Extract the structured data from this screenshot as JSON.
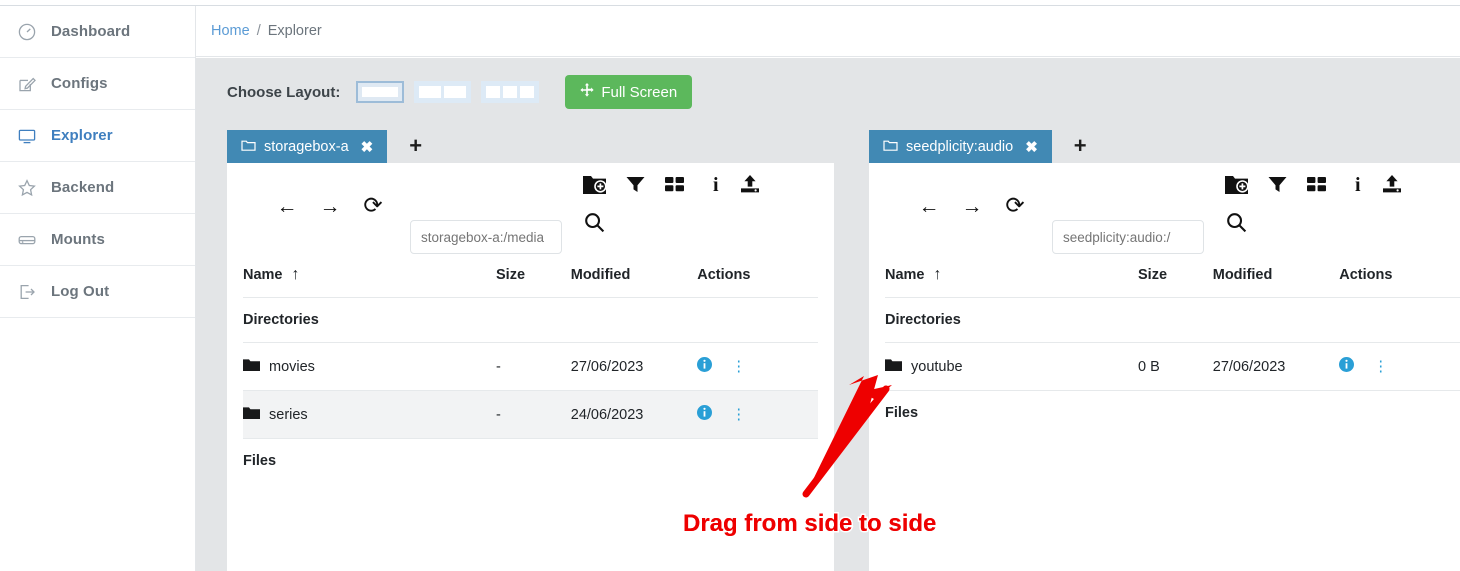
{
  "sidebar": {
    "items": [
      {
        "label": "Dashboard",
        "icon": "gauge-icon",
        "active": false
      },
      {
        "label": "Configs",
        "icon": "edit-square-icon",
        "active": false
      },
      {
        "label": "Explorer",
        "icon": "monitor-icon",
        "active": true
      },
      {
        "label": "Backend",
        "icon": "star-icon",
        "active": false
      },
      {
        "label": "Mounts",
        "icon": "drive-icon",
        "active": false
      },
      {
        "label": "Log Out",
        "icon": "logout-icon",
        "active": false
      }
    ]
  },
  "breadcrumb": {
    "home": "Home",
    "separator": "/",
    "current": "Explorer"
  },
  "toolbar": {
    "choose_layout_label": "Choose Layout:",
    "layout_options": [
      {
        "panes": 1,
        "selected": true
      },
      {
        "panes": 2,
        "selected": false
      },
      {
        "panes": 3,
        "selected": false
      }
    ],
    "full_screen_label": "Full Screen",
    "full_screen_icon": "arrows-move-icon",
    "full_screen_color": "#5cb85c"
  },
  "panels": [
    {
      "tab": {
        "label": "storagebox-a",
        "icon": "folder-outline-icon",
        "close": "✖",
        "color": "#4189b4"
      },
      "add_tab": "+",
      "nav": {
        "back": "←",
        "forward": "→",
        "refresh": "⟳"
      },
      "path": {
        "value": "storagebox-a:/media",
        "placeholder": "storagebox-a:/media"
      },
      "actions": [
        "new-folder-icon",
        "filter-icon",
        "grid-view-icon",
        "info-icon",
        "upload-icon",
        "search-icon"
      ],
      "columns": [
        "Name",
        "Size",
        "Modified",
        "Actions"
      ],
      "sort": {
        "column": "Name",
        "direction": "asc",
        "glyph": "↑"
      },
      "groups": [
        {
          "label": "Directories",
          "rows": [
            {
              "name": "movies",
              "size": "-",
              "modified": "27/06/2023",
              "icon": "folder-icon",
              "highlighted": false
            },
            {
              "name": "series",
              "size": "-",
              "modified": "24/06/2023",
              "icon": "folder-icon",
              "highlighted": true
            }
          ]
        },
        {
          "label": "Files",
          "rows": []
        }
      ],
      "row_actions": {
        "info": "i",
        "menu": "⋮"
      }
    },
    {
      "tab": {
        "label": "seedplicity:audio",
        "icon": "folder-outline-icon",
        "close": "✖",
        "color": "#4189b4"
      },
      "add_tab": "+",
      "nav": {
        "back": "←",
        "forward": "→",
        "refresh": "⟳"
      },
      "path": {
        "value": "seedplicity:audio:/",
        "placeholder": "seedplicity:audio:/"
      },
      "actions": [
        "new-folder-icon",
        "filter-icon",
        "grid-view-icon",
        "info-icon",
        "upload-icon",
        "search-icon"
      ],
      "columns": [
        "Name",
        "Size",
        "Modified",
        "Actions"
      ],
      "sort": {
        "column": "Name",
        "direction": "asc",
        "glyph": "↑"
      },
      "groups": [
        {
          "label": "Directories",
          "rows": [
            {
              "name": "youtube",
              "size": "0 B",
              "modified": "27/06/2023",
              "icon": "folder-icon",
              "highlighted": false
            }
          ]
        },
        {
          "label": "Files",
          "rows": []
        }
      ],
      "row_actions": {
        "info": "i",
        "menu": "⋮"
      }
    }
  ],
  "annotation": {
    "text": "Drag from side to side",
    "color": "#ee0000",
    "arrow": "drag-arrow"
  }
}
